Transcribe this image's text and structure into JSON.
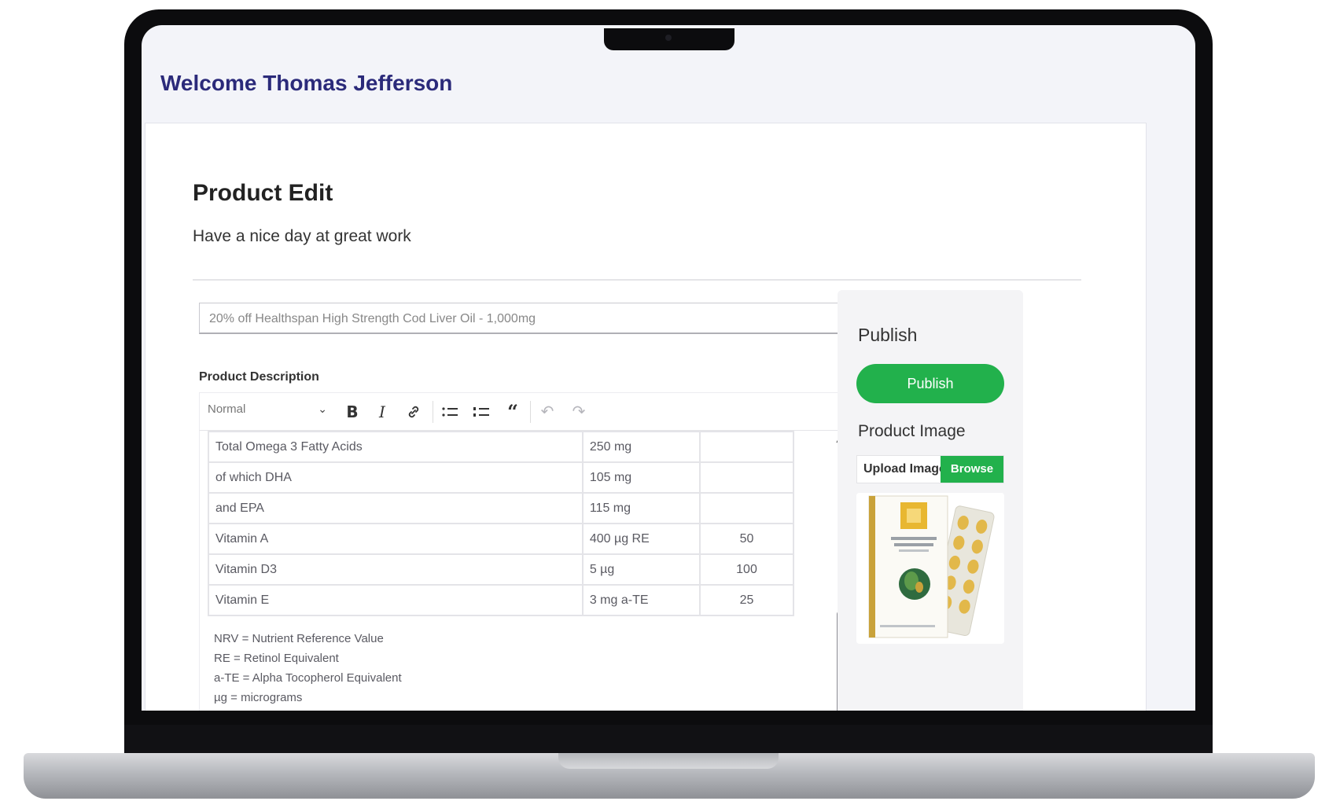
{
  "header": {
    "welcome": "Welcome Thomas Jefferson"
  },
  "page": {
    "title": "Product Edit",
    "subtitle": "Have a nice day at great work"
  },
  "product": {
    "name_value": "20% off Healthspan High Strength Cod Liver Oil - 1,000mg"
  },
  "description": {
    "label": "Product Description",
    "format_select": "Normal",
    "toolbar_icons": [
      "bold-icon",
      "italic-icon",
      "link-icon",
      "bullet-list-icon",
      "numbered-list-icon",
      "blockquote-icon",
      "undo-icon",
      "redo-icon"
    ],
    "rows": [
      {
        "name": "Total Omega 3 Fatty Acids",
        "amount": "250 mg",
        "nrv": ""
      },
      {
        "name": "of which DHA",
        "amount": "105 mg",
        "nrv": ""
      },
      {
        "name": "and EPA",
        "amount": "115 mg",
        "nrv": ""
      },
      {
        "name": "Vitamin A",
        "amount": "400 µg RE",
        "nrv": "50"
      },
      {
        "name": "Vitamin D3",
        "amount": "5 µg",
        "nrv": "100"
      },
      {
        "name": "Vitamin E",
        "amount": "3 mg a-TE",
        "nrv": "25"
      }
    ],
    "notes": [
      "NRV = Nutrient Reference Value",
      "RE = Retinol Equivalent",
      "a-TE = Alpha Tocopherol Equivalent",
      "µg = micrograms"
    ]
  },
  "sidebar": {
    "publish_title": "Publish",
    "publish_button": "Publish",
    "image_title": "Product Image",
    "upload_label": "Upload Image",
    "browse_button": "Browse"
  },
  "colors": {
    "accent_green": "#22b14c",
    "welcome_text": "#2b2a7a",
    "chat_button": "#1d6b4d"
  }
}
